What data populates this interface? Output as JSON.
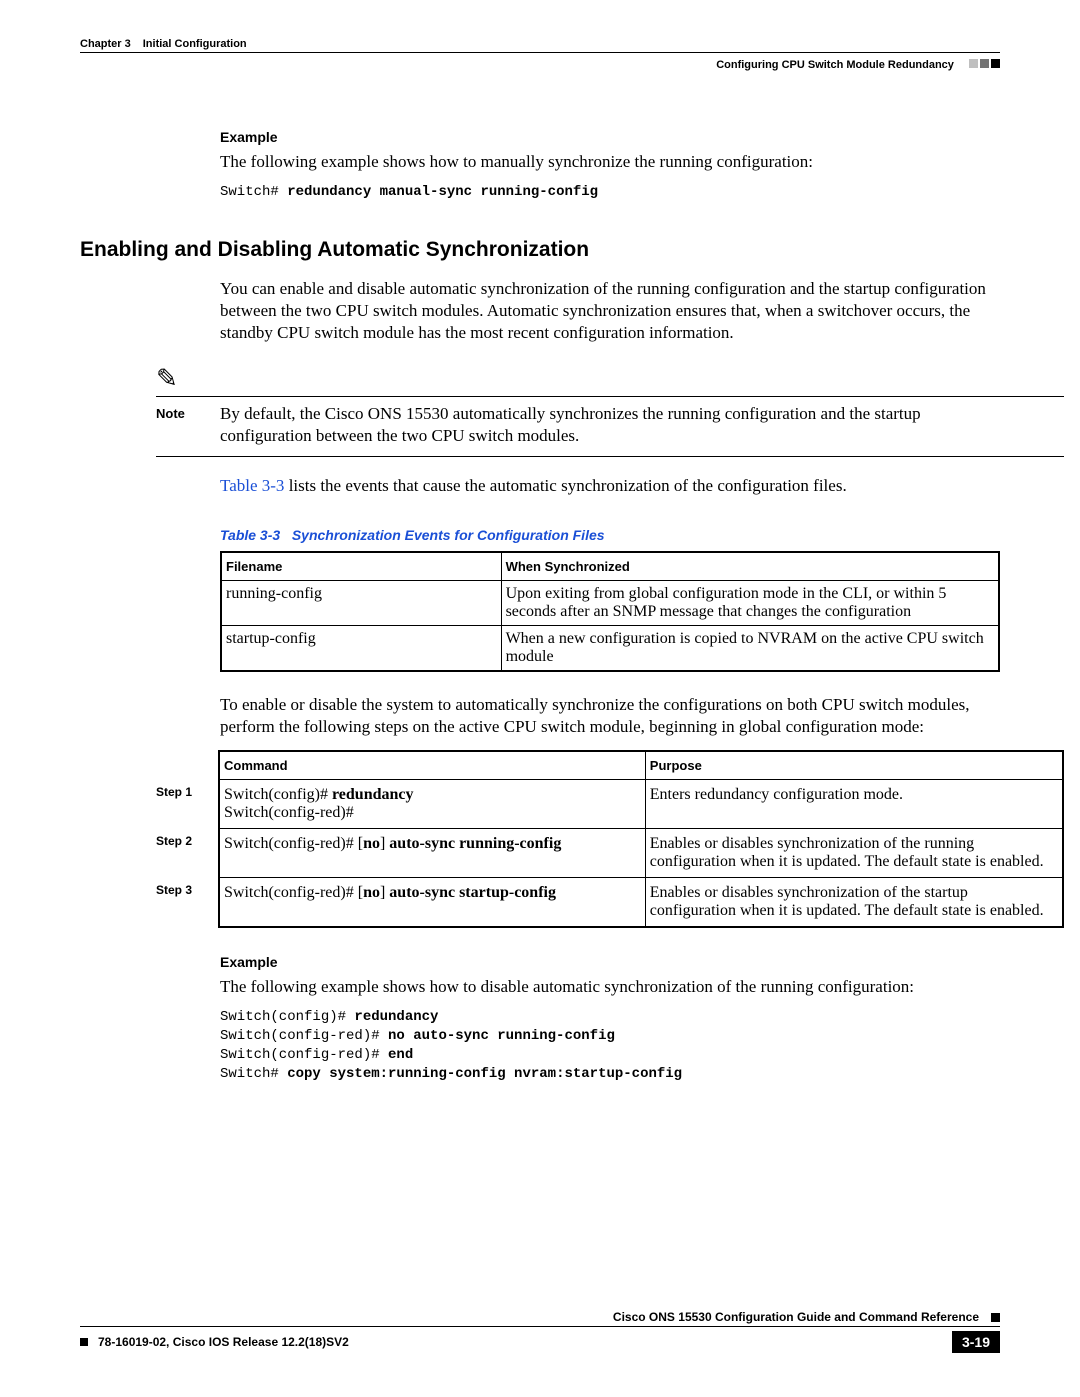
{
  "header": {
    "chapter_num": "Chapter 3",
    "chapter_title": "Initial Configuration",
    "section_title": "Configuring CPU Switch Module Redundancy"
  },
  "example1": {
    "heading": "Example",
    "intro": "The following example shows how to manually synchronize the running configuration:",
    "cli_prompt": "Switch# ",
    "cli_cmd": "redundancy manual-sync running-config"
  },
  "section_heading": "Enabling and Disabling Automatic Synchronization",
  "para1": "You can enable and disable automatic synchronization of the running configuration and the startup configuration between the two CPU switch modules. Automatic synchronization ensures that, when a switchover occurs, the standby CPU switch module has the most recent configuration information.",
  "note": {
    "label": "Note",
    "text": "By default, the Cisco ONS 15530 automatically synchronizes the running configuration and the startup configuration between the two CPU switch modules."
  },
  "para2_prefix": "Table 3-3",
  "para2_rest": " lists the events that cause the automatic synchronization of the configuration files.",
  "table33": {
    "caption_label": "Table 3-3",
    "caption_title": "Synchronization Events for Configuration Files",
    "col1": "Filename",
    "col2": "When Synchronized",
    "rows": [
      {
        "filename": "running-config",
        "when": "Upon exiting from global configuration mode in the CLI, or within 5 seconds after an SNMP message that changes the configuration"
      },
      {
        "filename": "startup-config",
        "when": "When a new configuration is copied to NVRAM on the active CPU switch module"
      }
    ]
  },
  "para3": "To enable or disable the system to automatically synchronize the configurations on both CPU switch modules, perform the following steps on the active CPU switch module, beginning in global configuration mode:",
  "steps_table": {
    "col1": "Command",
    "col2": "Purpose",
    "steps": [
      {
        "label": "Step 1",
        "cmd_plain1": "Switch(config)# ",
        "cmd_bold1": "redundancy",
        "cmd_line2": "Switch(config-red)#",
        "purpose": "Enters redundancy configuration mode."
      },
      {
        "label": "Step 2",
        "cmd_plain1": "Switch(config-red)# [",
        "cmd_bold1": "no",
        "cmd_plain2": "] ",
        "cmd_bold2": "auto-sync running-config",
        "purpose": "Enables or disables synchronization of the running configuration when it is updated. The default state is enabled."
      },
      {
        "label": "Step 3",
        "cmd_plain1": "Switch(config-red)# [",
        "cmd_bold1": "no",
        "cmd_plain2": "] ",
        "cmd_bold2": "auto-sync startup-config",
        "purpose": "Enables or disables synchronization of the startup configuration when it is updated. The default state is enabled."
      }
    ]
  },
  "example2": {
    "heading": "Example",
    "intro": "The following example shows how to disable automatic synchronization of the running configuration:",
    "lines": [
      {
        "p": "Switch(config)# ",
        "b": "redundancy"
      },
      {
        "p": "Switch(config-red)# ",
        "b": "no auto-sync running-config"
      },
      {
        "p": "Switch(config-red)# ",
        "b": "end"
      },
      {
        "p": "Switch# ",
        "b": "copy system:running-config nvram:startup-config"
      }
    ]
  },
  "footer": {
    "guide_title": "Cisco ONS 15530 Configuration Guide and Command Reference",
    "doc_id": "78-16019-02, Cisco IOS Release 12.2(18)SV2",
    "page_num": "3-19"
  }
}
